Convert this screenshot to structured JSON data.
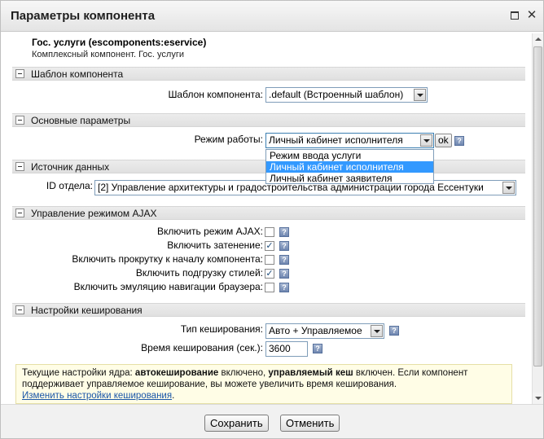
{
  "dialog": {
    "title": "Параметры компонента"
  },
  "component": {
    "name": "Гос. услуги (escomponents:eservice)",
    "description": "Комплексный компонент. Гос. услуги"
  },
  "sections": {
    "template": {
      "title": "Шаблон компонента",
      "template_label": "Шаблон компонента:",
      "template_value": ".default (Встроенный шаблон)"
    },
    "main": {
      "title": "Основные параметры",
      "mode_label": "Режим работы:",
      "mode_value": "Личный кабинет исполнителя",
      "ok_label": "ok",
      "mode_options": [
        "Режим ввода услуги",
        "Личный кабинет исполнителя",
        "Личный кабинет заявителя"
      ]
    },
    "data_source": {
      "title": "Источник данных",
      "dept_label": "ID отдела:",
      "dept_value": "[2] Управление архитектуры и градостроительства администрации города Ессентуки"
    },
    "ajax": {
      "title": "Управление режимом AJAX",
      "options": [
        {
          "label": "Включить режим AJAX:",
          "checked": false
        },
        {
          "label": "Включить затенение:",
          "checked": true
        },
        {
          "label": "Включить прокрутку к началу компонента:",
          "checked": false
        },
        {
          "label": "Включить подгрузку стилей:",
          "checked": true
        },
        {
          "label": "Включить эмуляцию навигации браузера:",
          "checked": false
        }
      ]
    },
    "cache": {
      "title": "Настройки кеширования",
      "type_label": "Тип кеширования:",
      "type_value": "Авто + Управляемое",
      "time_label": "Время кеширования (сек.):",
      "time_value": "3600"
    }
  },
  "note": {
    "text1": "Текущие настройки ядра: ",
    "bold1": "автокеширование",
    "text2": " включено, ",
    "bold2": "управляемый кеш",
    "text3": " включен. Если компонент поддерживает управляемое кеширование, вы можете увеличить время кеширования.",
    "link": "Изменить настройки кеширования",
    "tail": "."
  },
  "footer": {
    "save_label": "Сохранить",
    "cancel_label": "Отменить"
  },
  "icons": {
    "help": "?",
    "check": "✓",
    "close": "✕"
  },
  "colors": {
    "selection": "#3399ff",
    "link": "#1b57a8",
    "note_bg": "#fffde6"
  }
}
